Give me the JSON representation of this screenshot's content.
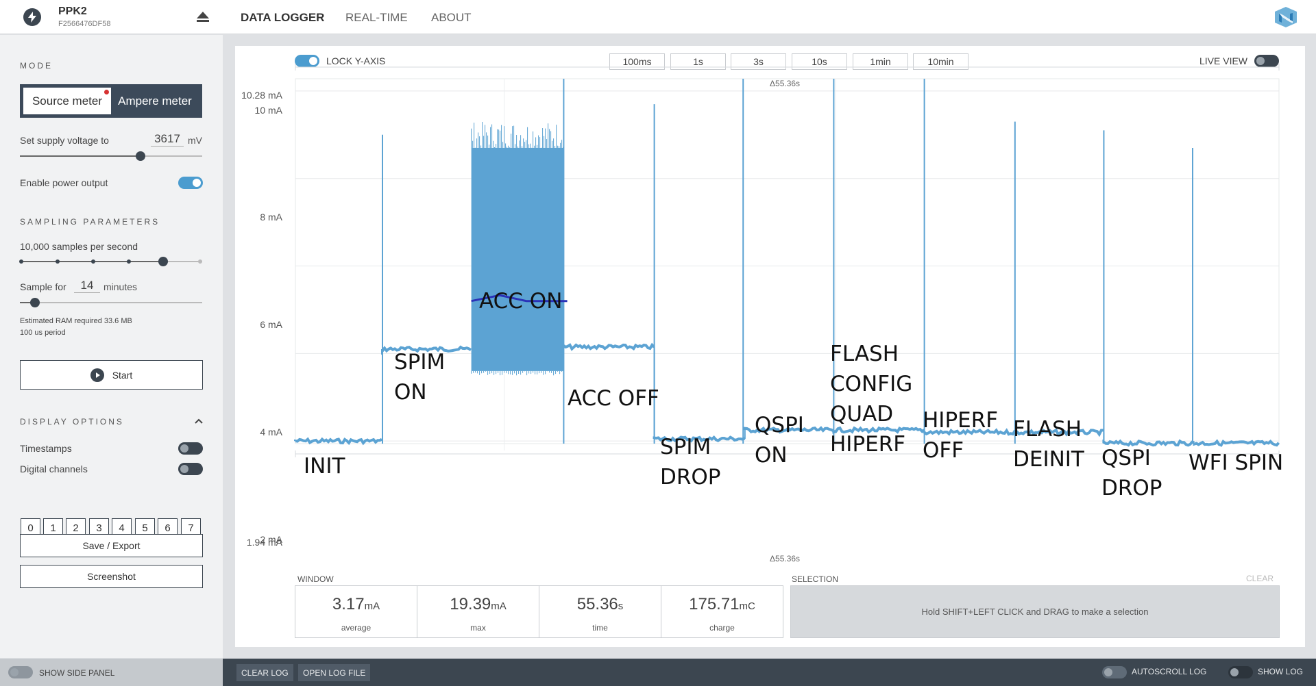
{
  "device": {
    "name": "PPK2",
    "serial": "F2566476DF58"
  },
  "nav": {
    "tabs": [
      "DATA LOGGER",
      "REAL-TIME",
      "ABOUT"
    ]
  },
  "side": {
    "mode_title": "MODE",
    "source_meter": "Source meter",
    "ampere_meter": "Ampere meter",
    "supply_label": "Set supply voltage to",
    "supply_value": "3617",
    "supply_unit": "mV",
    "supply_fraction": 0.667,
    "enable_power": "Enable power output",
    "sampling_title": "SAMPLING PARAMETERS",
    "samples_per_second": "10,000 samples per second",
    "sample_for_label": "Sample for",
    "sample_for_value": "14",
    "sample_for_unit": "minutes",
    "ram_required": "Estimated RAM required 33.6 MB",
    "period": "100 us period",
    "start": "Start",
    "display_title": "DISPLAY OPTIONS",
    "timestamps": "Timestamps",
    "digital_channels": "Digital channels",
    "channels": [
      "0",
      "1",
      "2",
      "3",
      "4",
      "5",
      "6",
      "7"
    ],
    "save_export": "Save / Export",
    "screenshot": "Screenshot",
    "show_side_panel": "SHOW SIDE PANEL"
  },
  "chart": {
    "lock_y_axis": "LOCK Y-AXIS",
    "live_view": "LIVE VIEW",
    "window_buttons": [
      "100ms",
      "1s",
      "3s",
      "10s",
      "1min",
      "10min"
    ],
    "delta_top": "Δ55.36s",
    "delta_bottom": "Δ55.36s",
    "y_labels": {
      "top": "10.28 mA",
      "y10": "10 mA",
      "y8": "8 mA",
      "y6": "6 mA",
      "y4": "4 mA",
      "y2": "2 mA",
      "bottom": "1.94 mA"
    },
    "annotations": {
      "init": "INIT",
      "spim_on": "SPIM\nON",
      "acc_on": "ACC ON",
      "acc_off": "ACC OFF",
      "spim_drop": "SPIM\nDROP",
      "qspi_on": "QSPI\nON",
      "flash_config": "FLASH\nCONFIG\nQUAD\nHIPERF",
      "hiperf_off": "HIPERF\nOFF",
      "flash_deinit": "FLASH\nDEINIT",
      "qspi_drop": "QSPI\nDROP",
      "wfi_spin": "WFI SPIN"
    },
    "trace_color": "#5ca3d3",
    "marker_color": "#2a32b8"
  },
  "chart_data": {
    "type": "line",
    "title": "",
    "xlabel": "",
    "ylabel": "",
    "ylim": [
      1.94,
      10.28
    ],
    "y_unit": "mA",
    "window_seconds": 55.36,
    "segments": [
      {
        "label": "INIT",
        "t_start": 0.0,
        "t_end": 4.9,
        "level": 2.0
      },
      {
        "label": "SPIM ON",
        "t_start": 4.9,
        "t_end": 9.9,
        "level": 4.1
      },
      {
        "label": "ACC ON",
        "t_start": 9.9,
        "t_end": 15.1,
        "level": 4.1,
        "max": 9.3,
        "min": 3.5,
        "band": [
          3.6,
          8.7
        ]
      },
      {
        "label": "ACC OFF",
        "t_start": 15.1,
        "t_end": 20.2,
        "level": 4.15
      },
      {
        "label": "SPIM DROP",
        "t_start": 20.2,
        "t_end": 25.3,
        "level": 2.05
      },
      {
        "label": "QSPI ON",
        "t_start": 25.3,
        "t_end": 30.3,
        "level": 2.25
      },
      {
        "label": "FLASH CONFIG QUAD HIPERF",
        "t_start": 30.3,
        "t_end": 35.4,
        "level": 2.25
      },
      {
        "label": "HIPERF OFF",
        "t_start": 35.4,
        "t_end": 40.5,
        "level": 2.2
      },
      {
        "label": "FLASH DEINIT",
        "t_start": 40.5,
        "t_end": 45.5,
        "level": 2.2
      },
      {
        "label": "QSPI DROP",
        "t_start": 45.5,
        "t_end": 50.6,
        "level": 1.95
      },
      {
        "label": "WFI SPIN",
        "t_start": 50.6,
        "t_end": 55.36,
        "level": 1.95
      }
    ],
    "spikes": [
      {
        "t": 4.9,
        "peak": 9.0
      },
      {
        "t": 15.1,
        "peak": 10.28
      },
      {
        "t": 20.2,
        "peak": 9.7
      },
      {
        "t": 25.2,
        "peak": 10.28
      },
      {
        "t": 30.3,
        "peak": 10.28
      },
      {
        "t": 35.4,
        "peak": 10.28
      },
      {
        "t": 40.5,
        "peak": 9.3
      },
      {
        "t": 45.5,
        "peak": 9.1
      },
      {
        "t": 50.5,
        "peak": 8.7
      }
    ],
    "average_marker": {
      "t": [
        9.9,
        11.5,
        13.0,
        15.3
      ],
      "y": [
        5.2,
        5.33,
        5.2,
        5.2
      ]
    }
  },
  "stats": {
    "window_label": "WINDOW",
    "selection_label": "SELECTION",
    "clear": "CLEAR",
    "average": {
      "value": "3.17",
      "unit": "mA",
      "caption": "average"
    },
    "max": {
      "value": "19.39",
      "unit": "mA",
      "caption": "max"
    },
    "time": {
      "value": "55.36",
      "unit": "s",
      "caption": "time"
    },
    "charge": {
      "value": "175.71",
      "unit": "mC",
      "caption": "charge"
    },
    "selection_hint": "Hold SHIFT+LEFT CLICK and DRAG to make a selection"
  },
  "footer": {
    "clear_log": "CLEAR LOG",
    "open_log_file": "OPEN LOG FILE",
    "autoscroll_log": "AUTOSCROLL LOG",
    "show_log": "SHOW LOG"
  }
}
